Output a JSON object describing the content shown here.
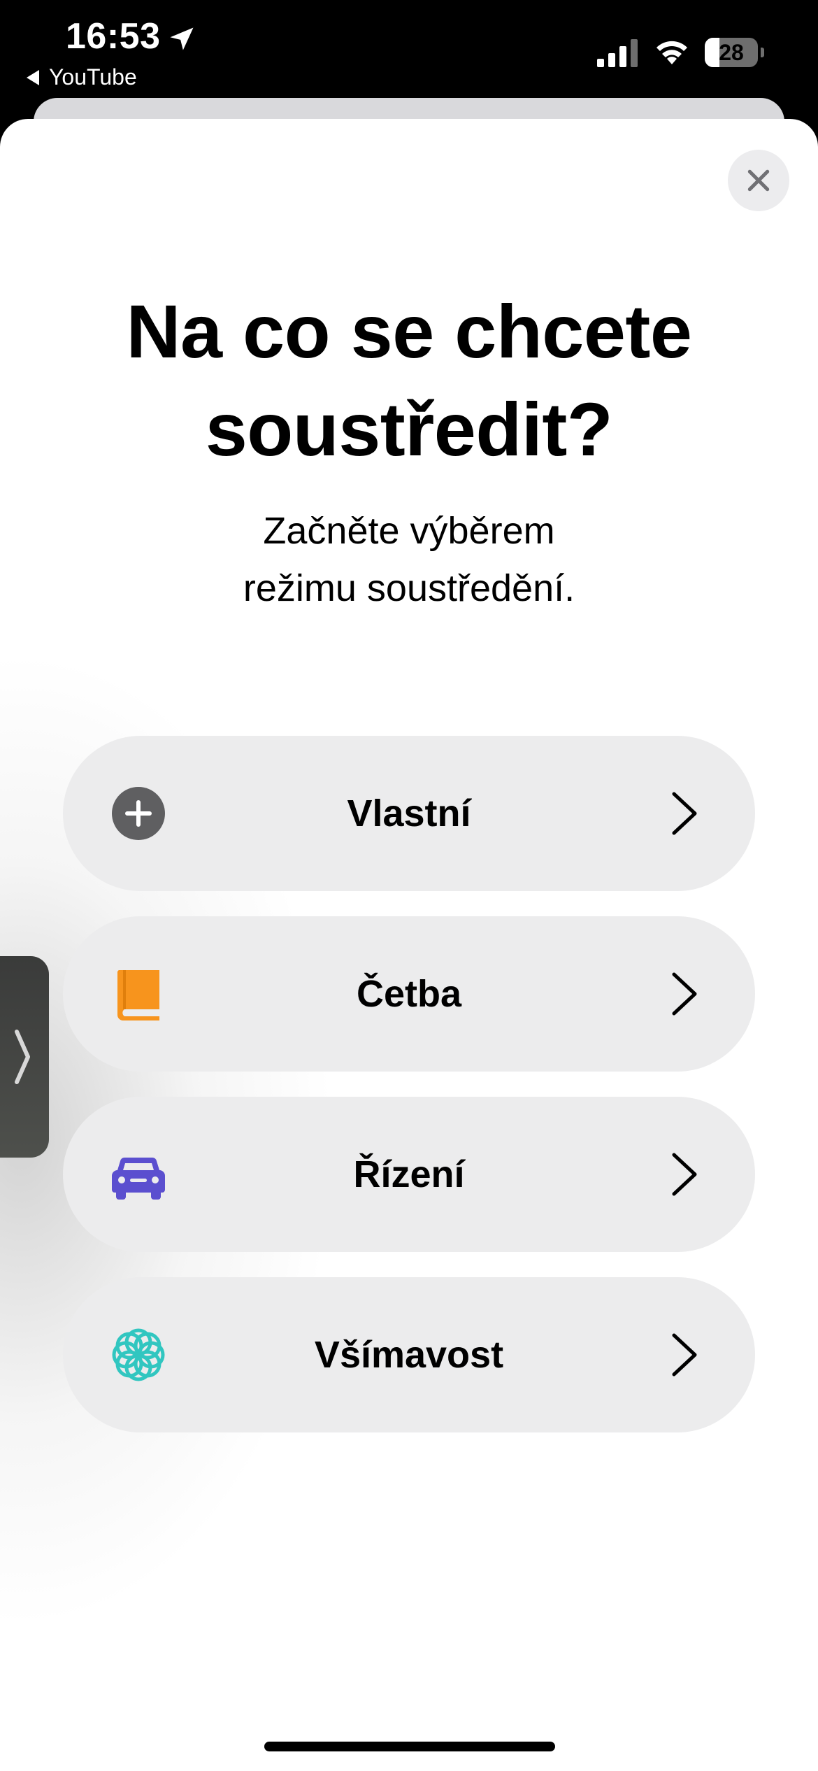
{
  "status_bar": {
    "time": "16:53",
    "back_app": "YouTube",
    "battery_level": "28",
    "battery_fraction": 0.28,
    "icons": [
      "location-arrow-icon",
      "cellular-signal-icon",
      "wifi-icon",
      "battery-icon"
    ]
  },
  "sheet": {
    "close_icon": "close-icon",
    "title": "Na co se chcete soustředit?",
    "subtitle_lines": [
      "Začněte výběrem",
      "režimu soustředění."
    ]
  },
  "options": [
    {
      "label": "Vlastní",
      "icon": "plus-circle-icon",
      "color": "#5f5f61"
    },
    {
      "label": "Četba",
      "icon": "book-icon",
      "color": "#f7941d"
    },
    {
      "label": "Řízení",
      "icon": "car-icon",
      "color": "#5b4fcf"
    },
    {
      "label": "Všímavost",
      "icon": "flower-icon",
      "color": "#31c6c0"
    }
  ],
  "colors": {
    "sheet_background": "#ffffff",
    "option_background": "#ececed",
    "status_bar_background": "#000000"
  }
}
